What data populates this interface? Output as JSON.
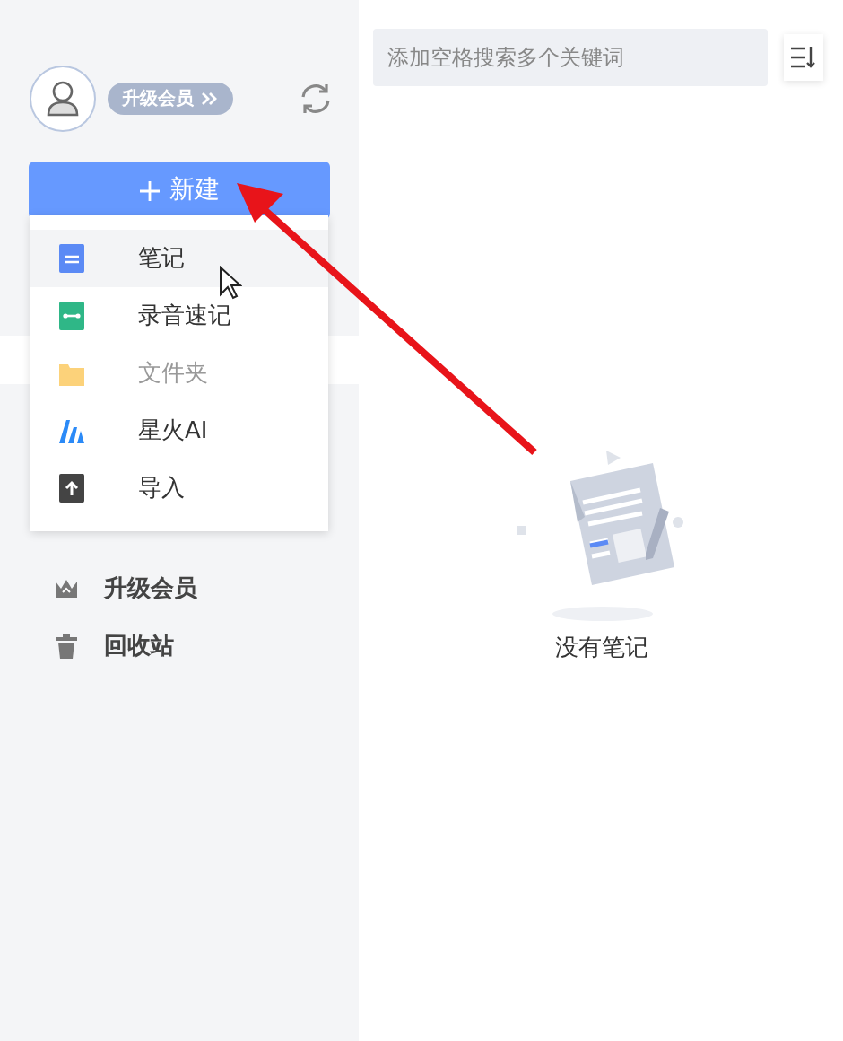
{
  "sidebar": {
    "vip_badge": "升级会员",
    "new_button": "新建",
    "items": [
      {
        "label": "升级会员"
      },
      {
        "label": "回收站"
      }
    ]
  },
  "new_menu": [
    {
      "label": "笔记",
      "selected": true,
      "disabled": false
    },
    {
      "label": "录音速记",
      "selected": false,
      "disabled": false
    },
    {
      "label": "文件夹",
      "selected": false,
      "disabled": true
    },
    {
      "label": "星火AI",
      "selected": false,
      "disabled": false
    },
    {
      "label": "导入",
      "selected": false,
      "disabled": false
    }
  ],
  "search": {
    "placeholder": "添加空格搜索多个关键词"
  },
  "empty_state": {
    "text": "没有笔记"
  }
}
